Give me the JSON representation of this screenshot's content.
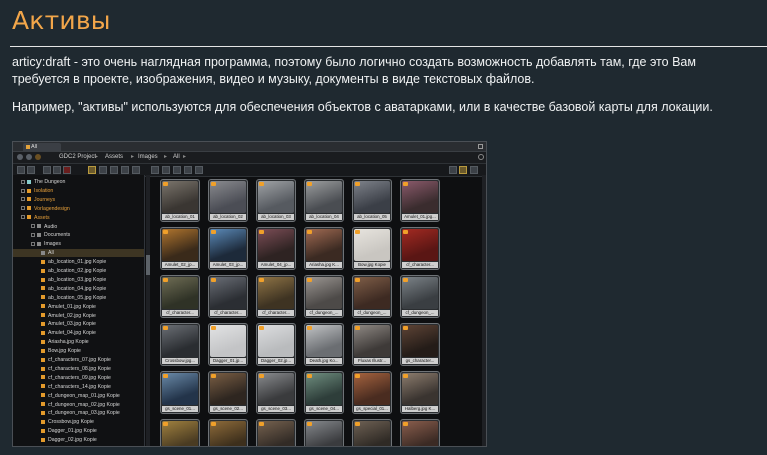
{
  "page": {
    "title": "Активы",
    "paragraph1": "articy:draft - это очень наглядная программа, поэтому было логично создать возможность добавлять там, где это Вам требуется в проекте, изображения, видео и музыку, документы в виде текстовых файлов.",
    "paragraph2": "Например, \"активы\" используются для обеспечения объектов с аватарками, или в качестве базовой карты для локации."
  },
  "app": {
    "tab_label": "All",
    "breadcrumbs": [
      "GDC2 Project",
      "Assets",
      "Images",
      "All"
    ],
    "tree": [
      {
        "label": "The Dungeon",
        "indent": 0,
        "color": "white",
        "icon": "project-icon"
      },
      {
        "label": "Isolation",
        "indent": 0,
        "color": "orange",
        "icon": "folder-icon"
      },
      {
        "label": "Journeys",
        "indent": 0,
        "color": "orange",
        "icon": "folder-icon"
      },
      {
        "label": "Vorlagendesign",
        "indent": 0,
        "color": "orange",
        "icon": "folder-icon"
      },
      {
        "label": "Assets",
        "indent": 0,
        "color": "orange",
        "icon": "folder-icon"
      },
      {
        "label": "Audio",
        "indent": 1,
        "color": "white",
        "icon": "folder-icon"
      },
      {
        "label": "Documents",
        "indent": 1,
        "color": "white",
        "icon": "folder-icon"
      },
      {
        "label": "Images",
        "indent": 1,
        "color": "white",
        "icon": "folder-icon"
      },
      {
        "label": "All",
        "indent": 2,
        "color": "white",
        "icon": "folder-icon",
        "selected": true
      },
      {
        "label": "ab_location_01.jpg Kopie",
        "indent": 2,
        "color": "white",
        "icon": "image-icon"
      },
      {
        "label": "ab_location_02.jpg Kopie",
        "indent": 2,
        "color": "white",
        "icon": "image-icon"
      },
      {
        "label": "ab_location_03.jpg Kopie",
        "indent": 2,
        "color": "white",
        "icon": "image-icon"
      },
      {
        "label": "ab_location_04.jpg Kopie",
        "indent": 2,
        "color": "white",
        "icon": "image-icon"
      },
      {
        "label": "ab_location_05.jpg Kopie",
        "indent": 2,
        "color": "white",
        "icon": "image-icon"
      },
      {
        "label": "Amulet_01.jpg Kopie",
        "indent": 2,
        "color": "white",
        "icon": "image-icon"
      },
      {
        "label": "Amulet_02.jpg Kopie",
        "indent": 2,
        "color": "white",
        "icon": "image-icon"
      },
      {
        "label": "Amulet_03.jpg Kopie",
        "indent": 2,
        "color": "white",
        "icon": "image-icon"
      },
      {
        "label": "Amulet_04.jpg Kopie",
        "indent": 2,
        "color": "white",
        "icon": "image-icon"
      },
      {
        "label": "Ariasha.jpg Kopie",
        "indent": 2,
        "color": "white",
        "icon": "image-icon"
      },
      {
        "label": "Bow.jpg Kopie",
        "indent": 2,
        "color": "white",
        "icon": "image-icon"
      },
      {
        "label": "cf_characters_07.jpg Kopie",
        "indent": 2,
        "color": "white",
        "icon": "image-icon"
      },
      {
        "label": "cf_characters_08.jpg Kopie",
        "indent": 2,
        "color": "white",
        "icon": "image-icon"
      },
      {
        "label": "cf_characters_09.jpg Kopie",
        "indent": 2,
        "color": "white",
        "icon": "image-icon"
      },
      {
        "label": "cf_characters_14.jpg Kopie",
        "indent": 2,
        "color": "white",
        "icon": "image-icon"
      },
      {
        "label": "cf_dungeon_map_01.jpg Kopie",
        "indent": 2,
        "color": "white",
        "icon": "image-icon"
      },
      {
        "label": "cf_dungeon_map_02.jpg Kopie",
        "indent": 2,
        "color": "white",
        "icon": "image-icon"
      },
      {
        "label": "cf_dungeon_map_03.jpg Kopie",
        "indent": 2,
        "color": "white",
        "icon": "image-icon"
      },
      {
        "label": "Crossbow.jpg Kopie",
        "indent": 2,
        "color": "white",
        "icon": "image-icon"
      },
      {
        "label": "Dagger_01.jpg Kopie",
        "indent": 2,
        "color": "white",
        "icon": "image-icon"
      },
      {
        "label": "Dagger_02.jpg Kopie",
        "indent": 2,
        "color": "white",
        "icon": "image-icon"
      }
    ],
    "tiles": [
      {
        "label": "ab_location_01",
        "colors": [
          "#3a3632",
          "#7b756c"
        ]
      },
      {
        "label": "ab_location_02",
        "colors": [
          "#4b4d55",
          "#8a8b8f"
        ]
      },
      {
        "label": "ab_location_03",
        "colors": [
          "#565a60",
          "#a0a3a6"
        ]
      },
      {
        "label": "ab_location_04",
        "colors": [
          "#4a4d52",
          "#9c9e9f"
        ]
      },
      {
        "label": "ab_location_05",
        "colors": [
          "#3b3f47",
          "#7e828a"
        ]
      },
      {
        "label": "Amulet_01.jpg...",
        "colors": [
          "#3a2c2e",
          "#8b5a6b"
        ]
      },
      {
        "label": "Amulet_02_jp...",
        "colors": [
          "#3a2a1a",
          "#b0752e"
        ]
      },
      {
        "label": "Amulet_03_jp...",
        "colors": [
          "#1d2a3a",
          "#5b8ab8"
        ]
      },
      {
        "label": "Amulet_04_jp...",
        "colors": [
          "#2e2322",
          "#7c4d56"
        ]
      },
      {
        "label": "Ariasha.jpg K...",
        "colors": [
          "#3b2a22",
          "#a06a52"
        ]
      },
      {
        "label": "Bow.jpg Kopie",
        "colors": [
          "#c9c6c1",
          "#e7e4de"
        ]
      },
      {
        "label": "cf_character...",
        "colors": [
          "#5a1614",
          "#a32a22"
        ]
      },
      {
        "label": "cf_character...",
        "colors": [
          "#2f3226",
          "#6f6d55"
        ]
      },
      {
        "label": "cf_character...",
        "colors": [
          "#2b2e33",
          "#6a6e76"
        ]
      },
      {
        "label": "cf_character...",
        "colors": [
          "#3e3322",
          "#8f7446"
        ]
      },
      {
        "label": "cf_dungeon_...",
        "colors": [
          "#4d4a48",
          "#9b9692"
        ]
      },
      {
        "label": "cf_dungeon_...",
        "colors": [
          "#3d2a22",
          "#7f5e48"
        ]
      },
      {
        "label": "cf_dungeon_...",
        "colors": [
          "#3a3e42",
          "#7c8388"
        ]
      },
      {
        "label": "Crossbow.jpg...",
        "colors": [
          "#2a2d31",
          "#6b6f75"
        ]
      },
      {
        "label": "Dagger_01.jp...",
        "colors": [
          "#c3c4c6",
          "#e2e3e4"
        ]
      },
      {
        "label": "Dagger_02.jp...",
        "colors": [
          "#b9bbbd",
          "#dcdddf"
        ]
      },
      {
        "label": "Death.jpg Ko...",
        "colors": [
          "#6b6e72",
          "#c1c3c5"
        ]
      },
      {
        "label": "Fluxas Illustr...",
        "colors": [
          "#3e3a38",
          "#8f8984"
        ]
      },
      {
        "label": "gs_character...",
        "colors": [
          "#241c18",
          "#5e4436"
        ]
      },
      {
        "label": "gs_scene_01...",
        "colors": [
          "#23344a",
          "#6a8aa8"
        ]
      },
      {
        "label": "gs_scene_02...",
        "colors": [
          "#2e2620",
          "#7a5e44"
        ]
      },
      {
        "label": "gs_scene_03...",
        "colors": [
          "#3a3b3d",
          "#8a8c8f"
        ]
      },
      {
        "label": "gs_scene_04...",
        "colors": [
          "#2e3e3a",
          "#6f8e7f"
        ]
      },
      {
        "label": "gs_special_01...",
        "colors": [
          "#4a2c20",
          "#a5633f"
        ]
      },
      {
        "label": "Halberg.jpg K...",
        "colors": [
          "#3a3430",
          "#8d7d6e"
        ]
      },
      {
        "label": "",
        "colors": [
          "#4a3b22",
          "#a0813f"
        ]
      },
      {
        "label": "",
        "colors": [
          "#3d2f1c",
          "#8e6b3a"
        ]
      },
      {
        "label": "",
        "colors": [
          "#322b26",
          "#76624f"
        ]
      },
      {
        "label": "",
        "colors": [
          "#3a3b3e",
          "#86898d"
        ]
      },
      {
        "label": "",
        "colors": [
          "#2f2a25",
          "#6e6154"
        ]
      },
      {
        "label": "",
        "colors": [
          "#3b2a24",
          "#8a5e4d"
        ]
      }
    ]
  }
}
